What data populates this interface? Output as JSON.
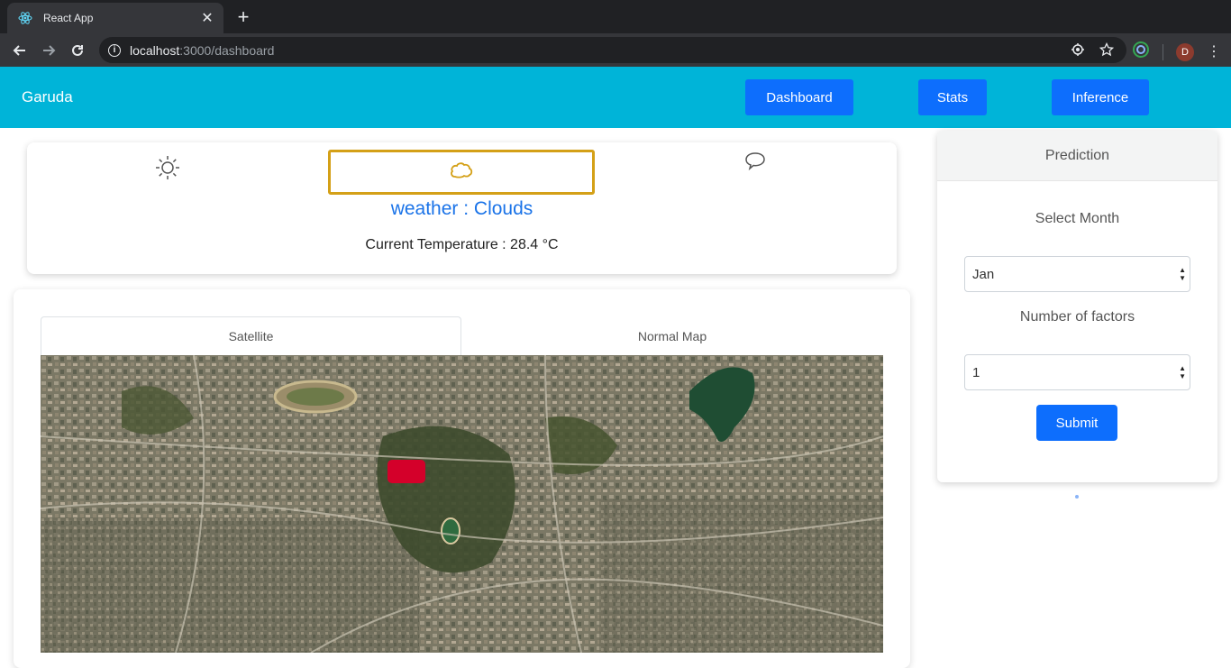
{
  "browser": {
    "tab_title": "React App",
    "url_host": "localhost",
    "url_path": ":3000/dashboard",
    "profile_initial": "D"
  },
  "navbar": {
    "brand": "Garuda",
    "links": [
      "Dashboard",
      "Stats",
      "Inference"
    ]
  },
  "weather": {
    "icons": [
      "sun-icon",
      "cloud-icon",
      "chat-bubble-icon"
    ],
    "selected_icon": "cloud-icon",
    "title": "weather : Clouds",
    "temperature": "Current Temperature : 28.4 °C"
  },
  "map": {
    "tabs": [
      "Satellite",
      "Normal Map"
    ],
    "active_tab": "Satellite",
    "marker_color": "#d4002a"
  },
  "prediction": {
    "header": "Prediction",
    "month_label": "Select Month",
    "month_value": "Jan",
    "factors_label": "Number of factors",
    "factors_value": "1",
    "submit_label": "Submit"
  },
  "colors": {
    "navbar": "#00b4d8",
    "primary_button": "#0d6efd",
    "weather_title": "#1a73e8",
    "selected_border": "#d4a017"
  }
}
